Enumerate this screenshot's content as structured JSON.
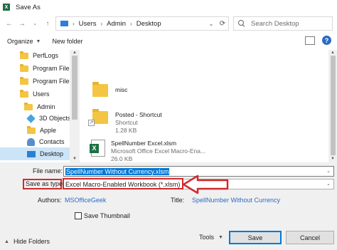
{
  "window": {
    "title": "Save As",
    "app_icon": "excel-icon"
  },
  "address_bar": {
    "breadcrumbs": [
      "Users",
      "Admin",
      "Desktop"
    ],
    "search_placeholder": "Search Desktop"
  },
  "toolbar": {
    "organize_label": "Organize",
    "new_folder_label": "New folder"
  },
  "nav_pane": {
    "items": [
      {
        "label": "PerfLogs",
        "icon": "folder-icon"
      },
      {
        "label": "Program Files",
        "icon": "folder-icon"
      },
      {
        "label": "Program Files (",
        "icon": "folder-icon"
      },
      {
        "label": "Users",
        "icon": "folder-icon"
      },
      {
        "label": "Admin",
        "icon": "folder-icon"
      },
      {
        "label": "3D Objects",
        "icon": "3d-objects-icon"
      },
      {
        "label": "Apple",
        "icon": "folder-icon"
      },
      {
        "label": "Contacts",
        "icon": "contacts-icon"
      },
      {
        "label": "Desktop",
        "icon": "desktop-icon",
        "selected": true
      }
    ]
  },
  "files": [
    {
      "name": "misc",
      "type": "",
      "size": "",
      "icon": "folder-icon"
    },
    {
      "name": "Posted - Shortcut",
      "type": "Shortcut",
      "size": "1.28 KB",
      "icon": "folder-shortcut-icon"
    },
    {
      "name": "SpellNumber Excel.xlsm",
      "type": "Microsoft Office Excel Macro-Ena...",
      "size": "26.0 KB",
      "icon": "excel-file-icon"
    }
  ],
  "form": {
    "file_name_label": "File name:",
    "file_name_value": "SpellNumber Without Currency.xlsm",
    "save_as_type_label": "Save as type:",
    "save_as_type_value": "Excel Macro-Enabled Workbook (*.xlsm)",
    "authors_label": "Authors:",
    "authors_value": "MSOfficeGeek",
    "title_label": "Title:",
    "title_value": "SpellNumber Without Currency",
    "save_thumbnail_label": "Save Thumbnail",
    "save_thumbnail_checked": false
  },
  "footer": {
    "hide_folders_label": "Hide Folders",
    "tools_label": "Tools",
    "save_label": "Save",
    "cancel_label": "Cancel"
  },
  "colors": {
    "accent": "#0078d7",
    "highlight_red": "#d12a2a",
    "link": "#2b6cc4"
  }
}
